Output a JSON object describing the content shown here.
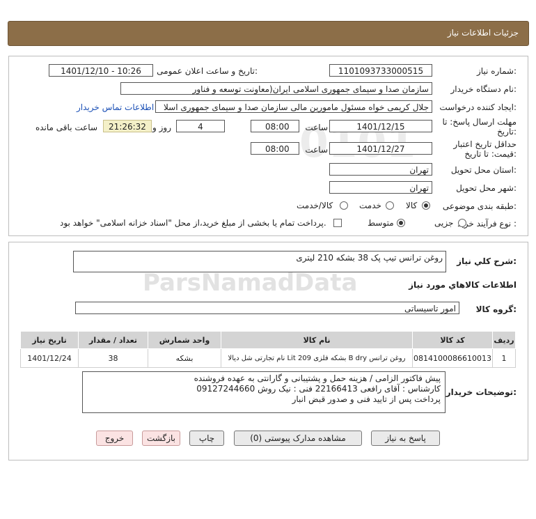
{
  "header": {
    "title": "جزئیات اطلاعات نیاز"
  },
  "fields": {
    "need_number": {
      "label": "شماره نیاز:",
      "value": "1101093733000515"
    },
    "announce_datetime": {
      "label": "تاریخ و ساعت اعلان عمومی:",
      "value": "1401/12/10 - 10:26"
    },
    "buyer_org": {
      "label": "نام دستگاه خریدار:",
      "value": "سازمان صدا و سیمای جمهوری اسلامی ایران(معاونت توسعه و فناور"
    },
    "requester": {
      "label": "ایجاد کننده درخواست:",
      "value": "جلال کریمی خواه مسئول مامورین مالی  سازمان صدا و سیمای جمهوری اسلا",
      "contact_link": "اطلاعات تماس خریدار"
    },
    "reply_deadline": {
      "label_line1": "مهلت ارسال پاسخ: تا",
      "label_line2": "تاریخ:",
      "date": "1401/12/15",
      "time_label": "ساعت",
      "time": "08:00",
      "days": "4",
      "days_label": "روز و",
      "remaining": "21:26:32",
      "remaining_label": "ساعت باقی مانده"
    },
    "price_validity": {
      "label_line1": "حداقل تاریخ اعتبار",
      "label_line2": "قیمت: تا تاریخ:",
      "date": "1401/12/27",
      "time_label": "ساعت",
      "time": "08:00"
    },
    "delivery_province": {
      "label": "استان محل تحویل:",
      "value": "تهران"
    },
    "delivery_city": {
      "label": "شهر محل تحویل:",
      "value": "تهران"
    },
    "category": {
      "label": "طبقه بندی موضوعی:",
      "options": [
        "کالا",
        "خدمت",
        "کالا/خدمت"
      ],
      "selected": "کالا"
    },
    "process_type": {
      "label": "نوع فرآیند خرید :",
      "options": [
        "جزیی",
        "متوسط"
      ],
      "selected": "متوسط",
      "payment_note": "پرداخت تمام یا بخشی از مبلغ خرید،از محل \"اسناد خزانه اسلامی\" خواهد بود."
    }
  },
  "summary": {
    "label": "شرح کلي نياز:",
    "value": "روغن ترانس تیپ پک 38 بشکه 210 لیتری"
  },
  "goods_info_title": "اطلاعات کالاهاي مورد نياز",
  "goods_group": {
    "label": "گروه کالا:",
    "value": "امور تاسیساتی"
  },
  "table": {
    "headers": [
      "ردیف",
      "کد کالا",
      "نام کالا",
      "واحد شمارش",
      "تعداد / مقدار",
      "تاریخ نیاز"
    ],
    "rows": [
      [
        "1",
        "0814100086610013",
        "روغن ترانس B dry بشکه فلزی 209 Lit نام تجارتی شل دیالا",
        "بشکه",
        "38",
        "1401/12/24"
      ]
    ]
  },
  "buyer_notes": {
    "label": "توضیحات خریدار:",
    "lines": [
      "پیش فاکتور الزامی / هزینه حمل و پشتیبانی و گارانتی به عهده فروشنده",
      "کارشناس : آقای رافعی 22166413   فنی : نیک روش 09127244660",
      "پرداخت پس از تایید فنی و صدور قبض انبار"
    ]
  },
  "buttons": {
    "reply": "پاسخ به نیاز",
    "attachments": "مشاهده مدارک پیوستی (0)",
    "print": "چاپ",
    "back": "بازگشت",
    "exit": "خروج"
  }
}
